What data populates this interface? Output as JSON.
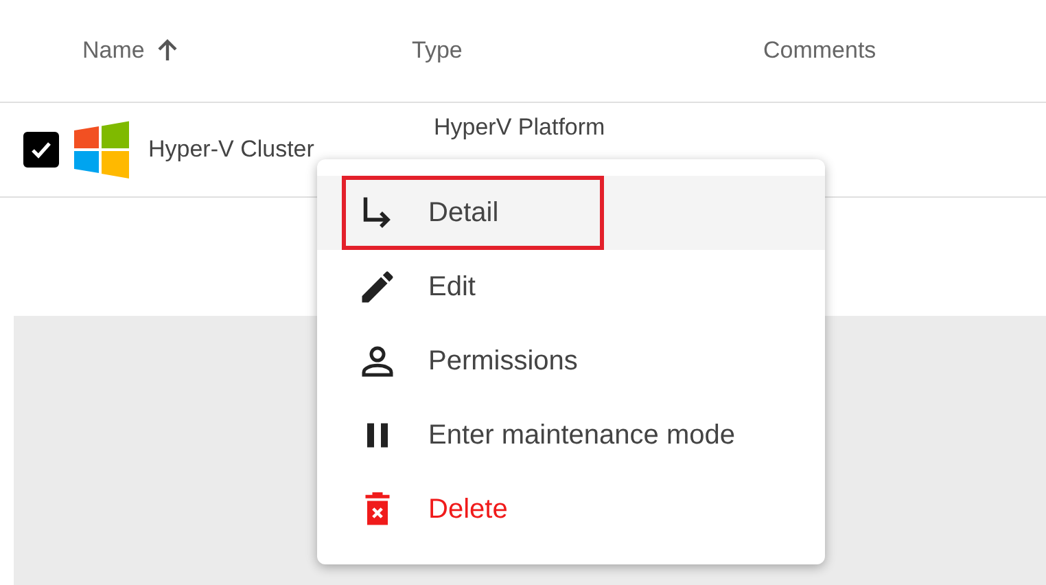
{
  "table": {
    "columns": [
      {
        "label": "Name",
        "sort_arrow": true
      },
      {
        "label": "Type",
        "sort_arrow": false
      },
      {
        "label": "Comments",
        "sort_arrow": false
      }
    ],
    "rows": [
      {
        "checked": true,
        "name": "Hyper-V Cluster",
        "type": "HyperV Platform"
      }
    ]
  },
  "context_menu": {
    "items": [
      {
        "kind": "detail",
        "label": "Detail",
        "hovered": true,
        "highlighted": true,
        "danger": false
      },
      {
        "kind": "edit",
        "label": "Edit",
        "hovered": false,
        "highlighted": false,
        "danger": false
      },
      {
        "kind": "permissions",
        "label": "Permissions",
        "hovered": false,
        "highlighted": false,
        "danger": false
      },
      {
        "kind": "maintenance",
        "label": "Enter maintenance mode",
        "hovered": false,
        "highlighted": false,
        "danger": false
      },
      {
        "kind": "delete",
        "label": "Delete",
        "hovered": false,
        "highlighted": false,
        "danger": true
      }
    ]
  }
}
